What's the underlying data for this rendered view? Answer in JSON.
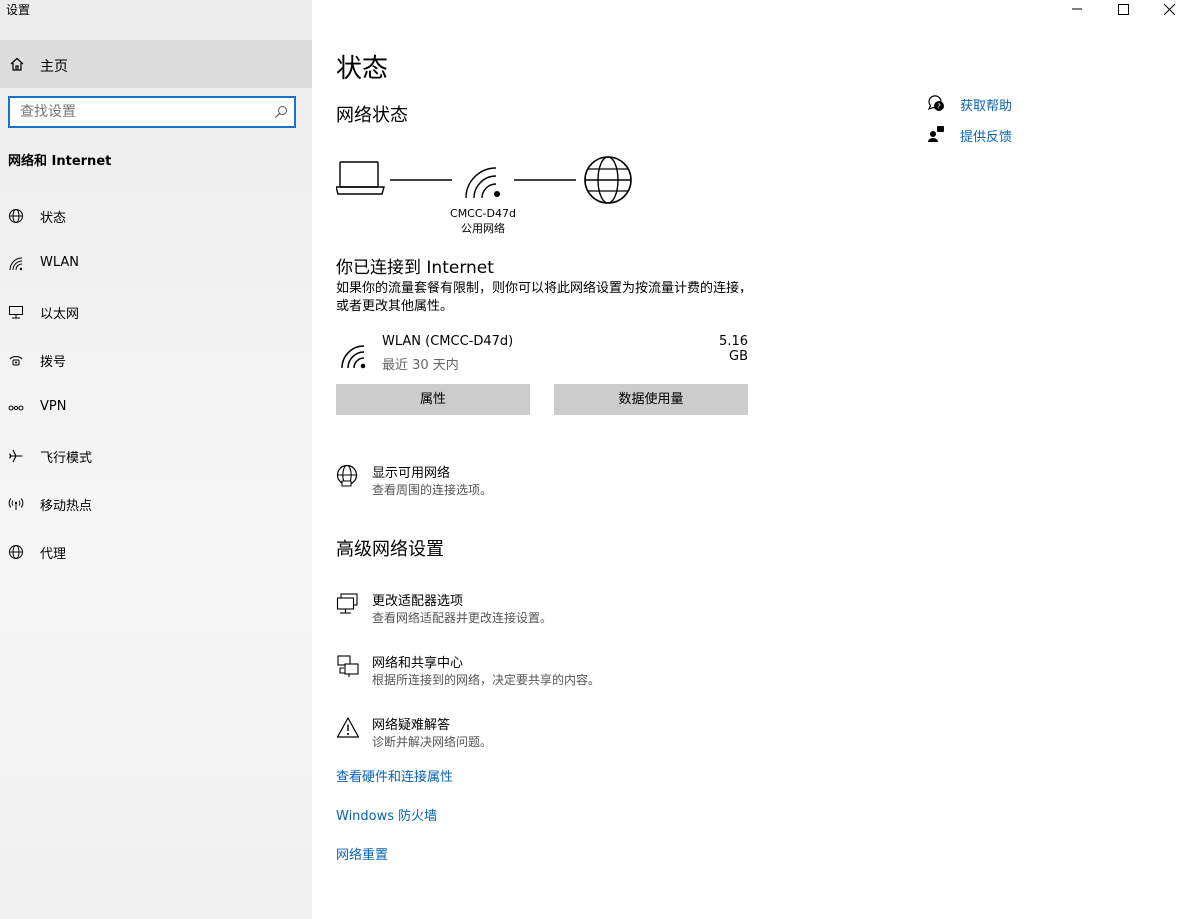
{
  "window": {
    "title": "设置"
  },
  "sidebar": {
    "home_label": "主页",
    "search_placeholder": "查找设置",
    "section_title": "网络和 Internet",
    "items": [
      {
        "label": "状态",
        "icon": "globe-icon"
      },
      {
        "label": "WLAN",
        "icon": "wifi-icon"
      },
      {
        "label": "以太网",
        "icon": "ethernet-icon"
      },
      {
        "label": "拨号",
        "icon": "dialup-icon"
      },
      {
        "label": "VPN",
        "icon": "vpn-icon"
      },
      {
        "label": "飞行模式",
        "icon": "airplane-icon"
      },
      {
        "label": "移动热点",
        "icon": "hotspot-icon"
      },
      {
        "label": "代理",
        "icon": "globe-icon"
      }
    ]
  },
  "main": {
    "title": "状态",
    "network_status_heading": "网络状态",
    "network_name": "CMCC-D47d",
    "network_type": "公用网络",
    "connected_heading": "你已连接到 Internet",
    "connected_desc": "如果你的流量套餐有限制，则你可以将此网络设置为按流量计费的连接，或者更改其他属性。",
    "connection": {
      "name": "WLAN (CMCC-D47d)",
      "period": "最近 30 天内",
      "usage": "5.16 GB"
    },
    "buttons": {
      "properties": "属性",
      "data_usage": "数据使用量"
    },
    "show_networks": {
      "title": "显示可用网络",
      "desc": "查看周围的连接选项。"
    },
    "advanced_heading": "高级网络设置",
    "advanced_options": [
      {
        "title": "更改适配器选项",
        "desc": "查看网络适配器并更改连接设置。"
      },
      {
        "title": "网络和共享中心",
        "desc": "根据所连接到的网络，决定要共享的内容。"
      },
      {
        "title": "网络疑难解答",
        "desc": "诊断并解决网络问题。"
      }
    ],
    "links": [
      "查看硬件和连接属性",
      "Windows 防火墙",
      "网络重置"
    ]
  },
  "help": {
    "get_help": "获取帮助",
    "feedback": "提供反馈"
  },
  "colors": {
    "accent": "#0a63b3",
    "search_border": "#1a73c8",
    "button_bg": "#cccccc"
  }
}
